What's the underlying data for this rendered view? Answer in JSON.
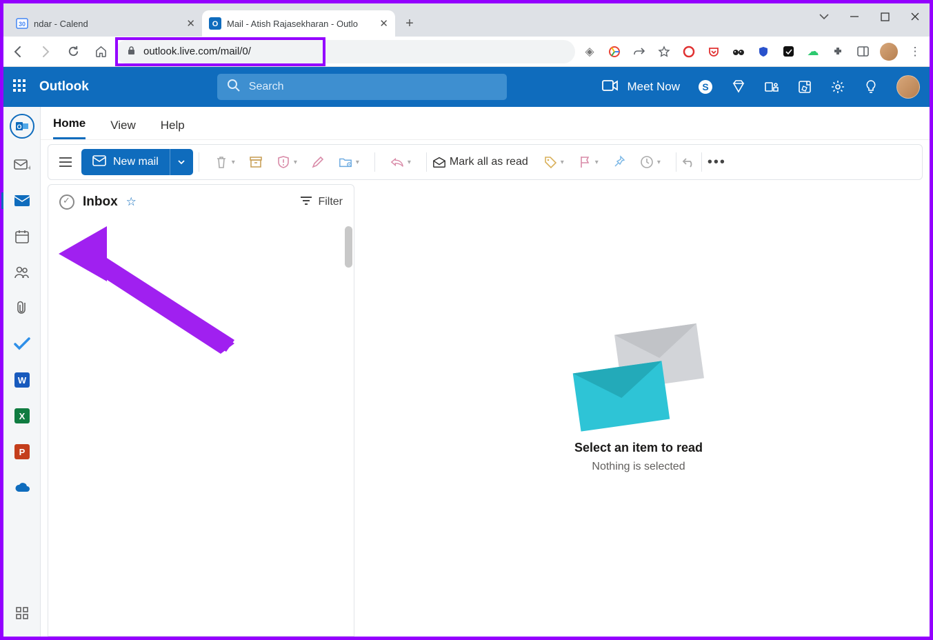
{
  "browser": {
    "tabs": [
      {
        "title": "ndar - Calend",
        "active": false
      },
      {
        "title": "Mail - Atish Rajasekharan - Outlo",
        "active": true
      }
    ],
    "url": "outlook.live.com/mail/0/"
  },
  "suite": {
    "brand": "Outlook",
    "search_placeholder": "Search",
    "meet_now": "Meet Now"
  },
  "ribbon": {
    "tabs": {
      "home": "Home",
      "view": "View",
      "help": "Help"
    },
    "new_mail": "New mail",
    "mark_read": "Mark all as read"
  },
  "list": {
    "title": "Inbox",
    "filter": "Filter"
  },
  "reading": {
    "title": "Select an item to read",
    "subtitle": "Nothing is selected"
  }
}
